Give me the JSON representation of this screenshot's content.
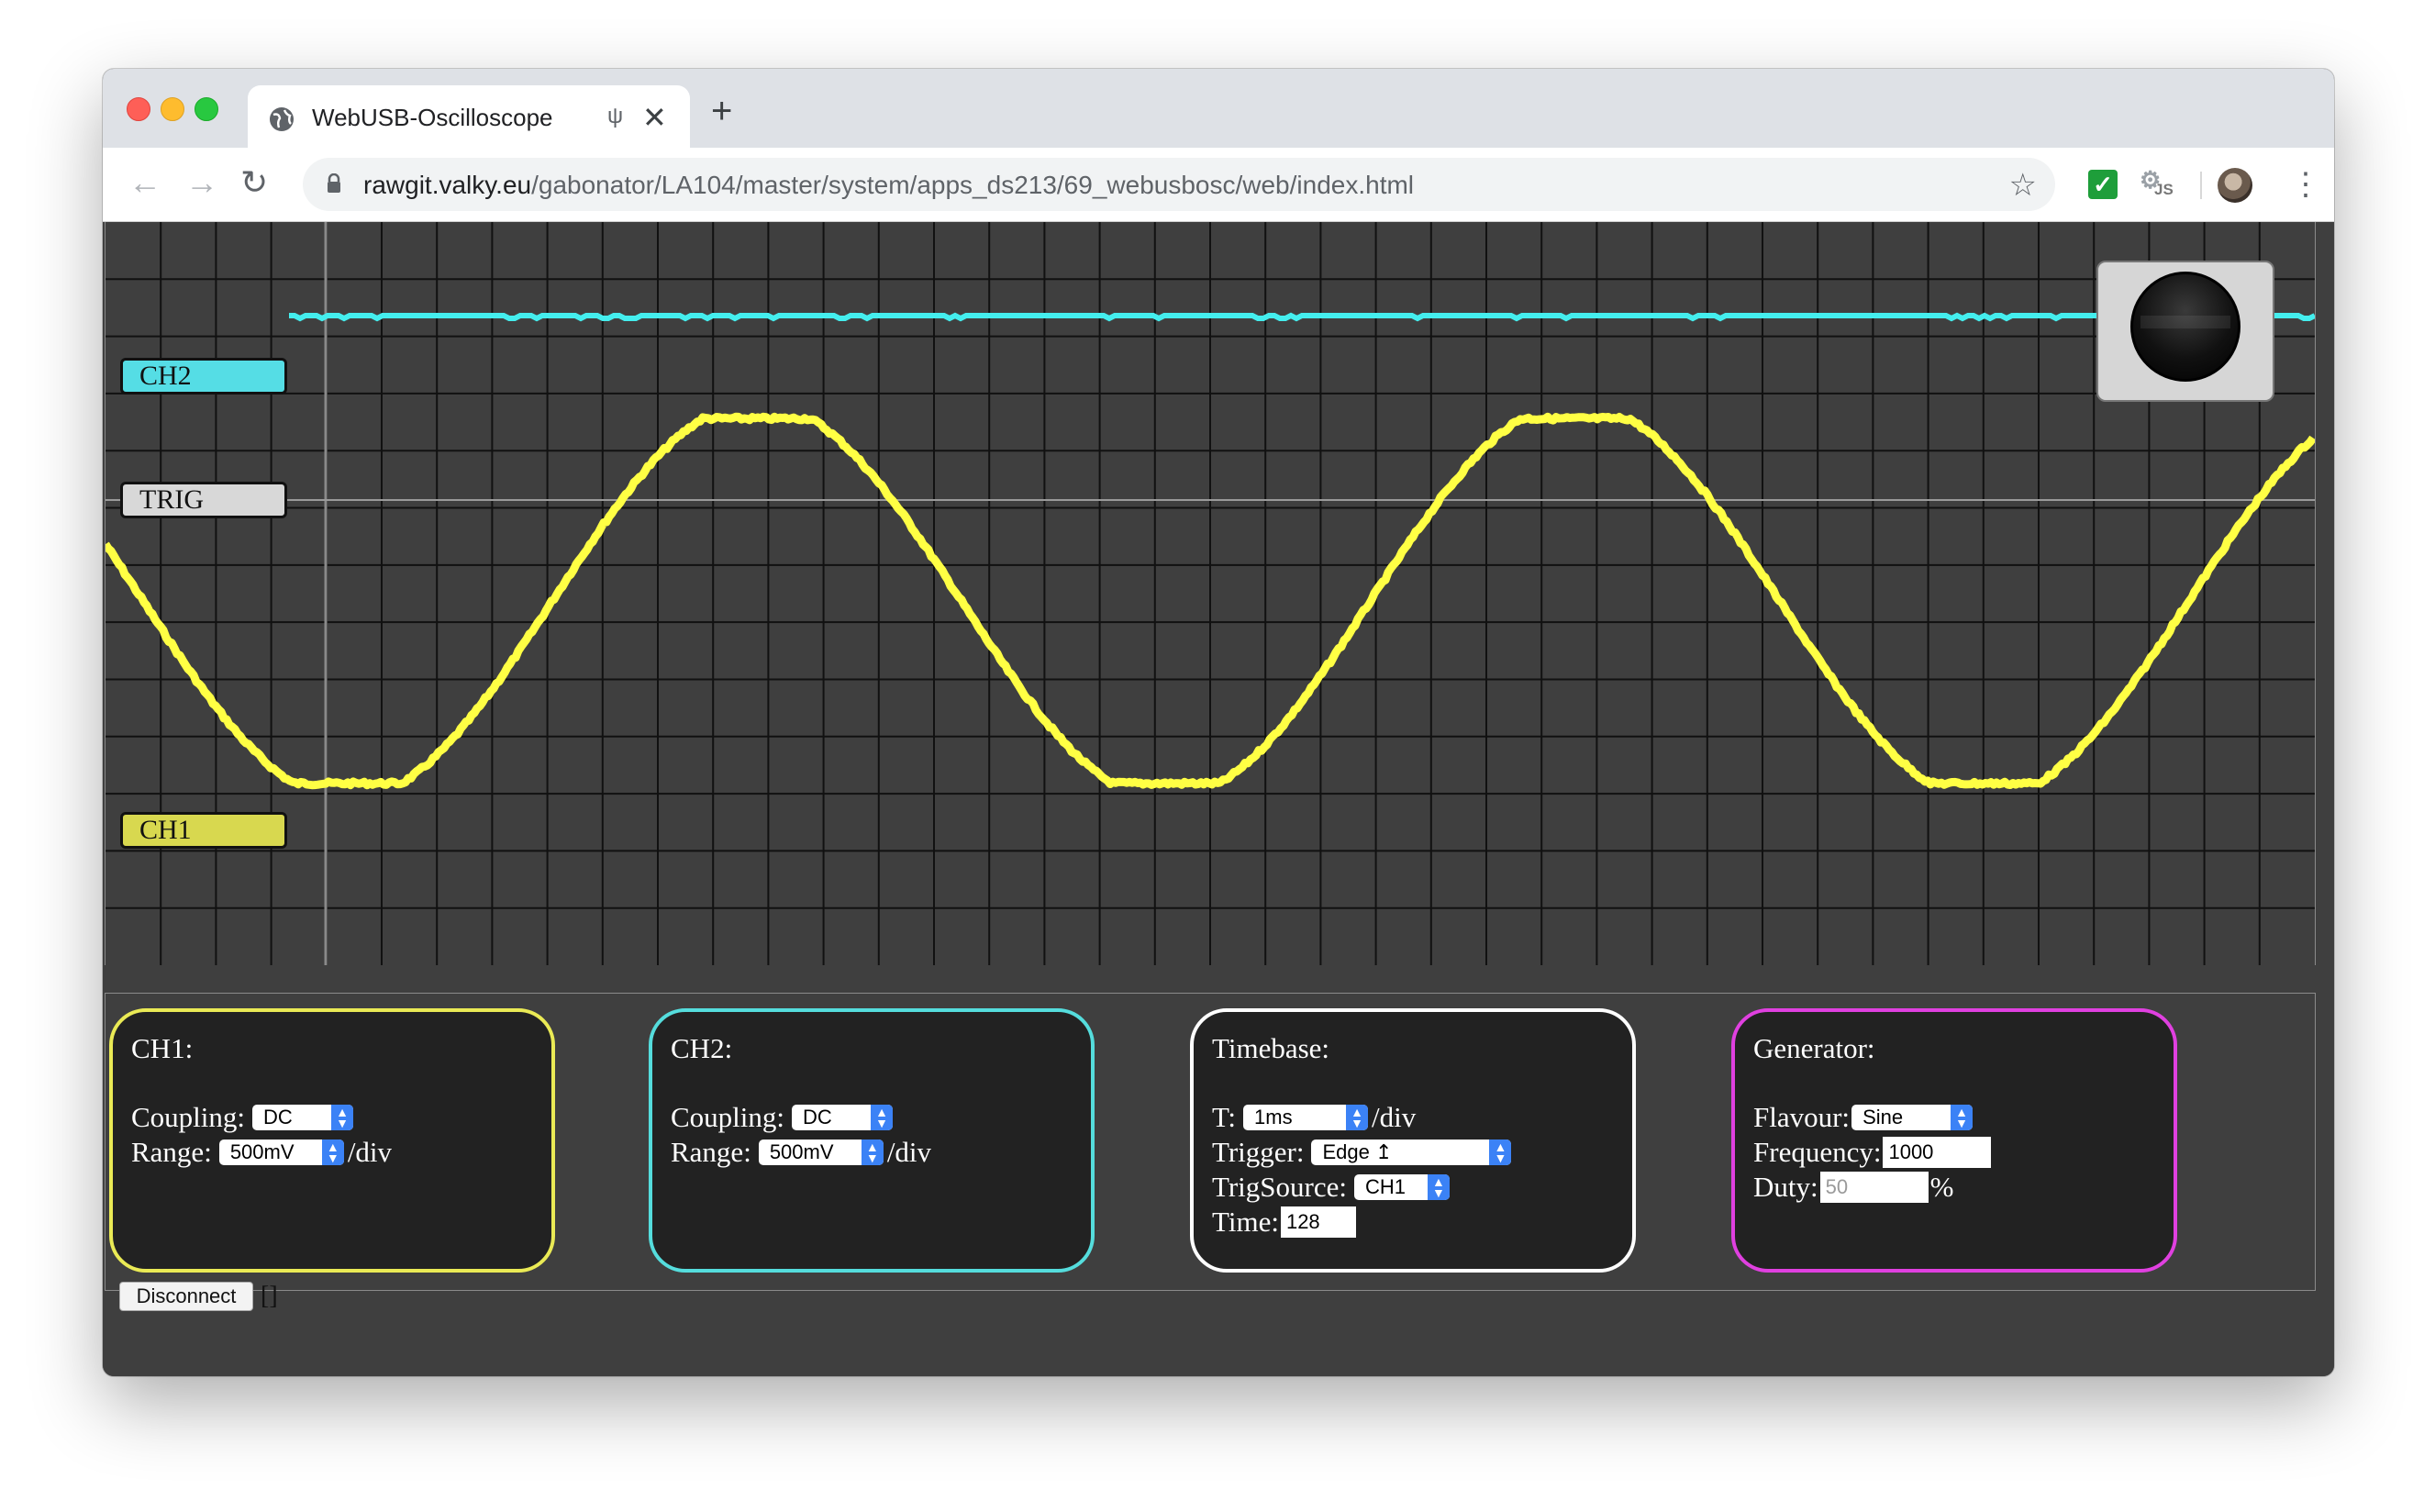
{
  "browser": {
    "tab_title": "WebUSB-Oscilloscope",
    "url_host": "rawgit.valky.eu",
    "url_path": "/gabonator/LA104/master/system/apps_ds213/69_webusbosc/web/index.html",
    "ext_js_label": "JS"
  },
  "scope": {
    "labels": {
      "ch2": "CH2",
      "trig": "TRIG",
      "ch1": "CH1"
    },
    "colors": {
      "ch1": "#ffff44",
      "ch2": "#44eeee",
      "grid": "#111111",
      "background": "#3f3f3f",
      "cursor": "#8a8a8a"
    },
    "ch1_waveform": {
      "shape": "sine",
      "cycles_visible": 2.7
    },
    "ch2_waveform": {
      "shape": "flat"
    }
  },
  "panels": {
    "ch1": {
      "title": "CH1:",
      "coupling_label": "Coupling:",
      "coupling_value": "DC",
      "range_label": "Range:",
      "range_value": "500mV",
      "range_unit": "/div",
      "border_color": "#eaea55"
    },
    "ch2": {
      "title": "CH2:",
      "coupling_label": "Coupling:",
      "coupling_value": "DC",
      "range_label": "Range:",
      "range_value": "500mV",
      "range_unit": "/div",
      "border_color": "#55dddd"
    },
    "timebase": {
      "title": "Timebase:",
      "t_label": "T:",
      "t_value": "1ms",
      "t_unit": "/div",
      "trigger_label": "Trigger:",
      "trigger_value": "Edge ↥",
      "trigsource_label": "TrigSource:",
      "trigsource_value": "CH1",
      "time_label": "Time:",
      "time_value": "128",
      "border_color": "#ffffff"
    },
    "generator": {
      "title": "Generator:",
      "flavour_label": "Flavour:",
      "flavour_value": "Sine",
      "frequency_label": "Frequency:",
      "frequency_value": "1000",
      "duty_label": "Duty:",
      "duty_placeholder": "50",
      "duty_unit": "%",
      "border_color": "#e040e0"
    }
  },
  "footer": {
    "disconnect_label": "Disconnect",
    "status": "[]"
  }
}
